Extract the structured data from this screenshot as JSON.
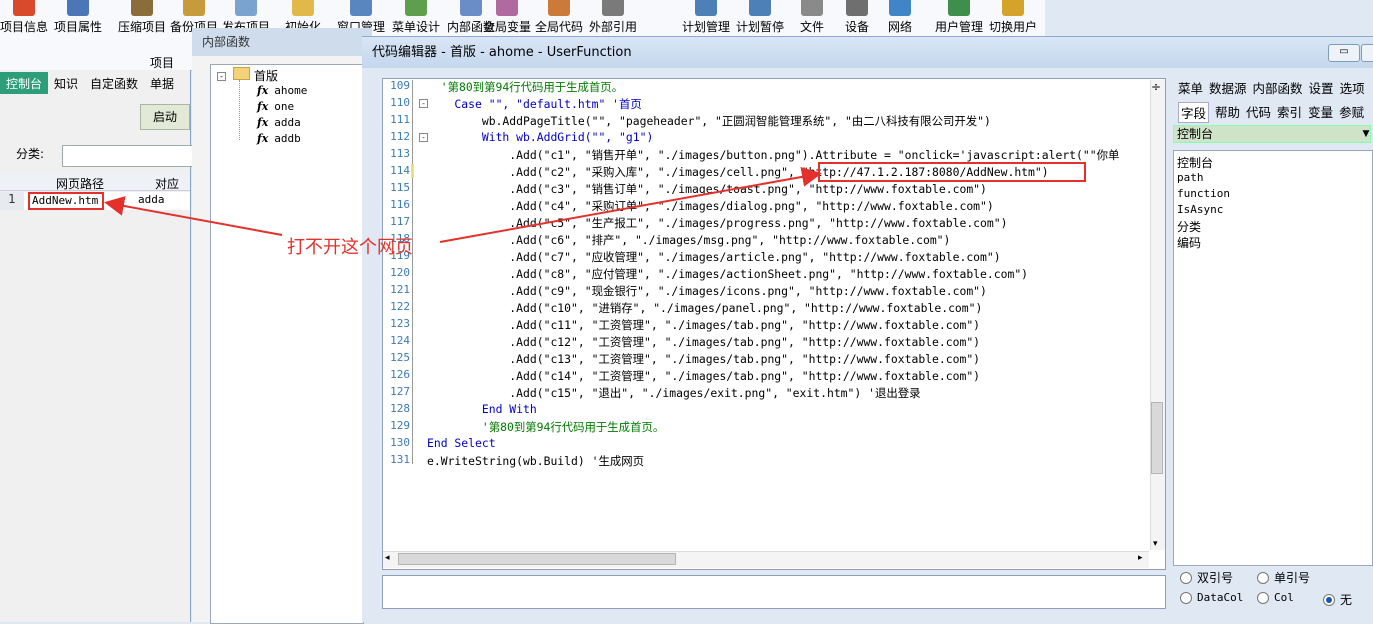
{
  "ribbon": {
    "buttons": [
      {
        "label": "项目信息",
        "color": "#d9492b"
      },
      {
        "label": "项目属性",
        "color": "#4b77b8"
      },
      {
        "label": "压缩项目",
        "color": "#8a6d3b"
      },
      {
        "label": "备份项目",
        "color": "#c79b3c"
      },
      {
        "label": "发布项目",
        "color": "#7aa3cf"
      },
      {
        "label": "初始化",
        "color": "#e0b94a"
      },
      {
        "label": "窗口管理",
        "color": "#5a86c0"
      },
      {
        "label": "菜单设计",
        "color": "#5f9e4c"
      },
      {
        "label": "内部函数",
        "color": "#6a8cc7"
      },
      {
        "label": "全局变量",
        "color": "#b06aa0"
      },
      {
        "label": "全局代码",
        "color": "#cc7a3a"
      },
      {
        "label": "外部引用",
        "color": "#7a7a7a"
      },
      {
        "label": "计划管理",
        "color": "#4e80b8"
      },
      {
        "label": "计划暂停",
        "color": "#4e80b8"
      },
      {
        "label": "文件",
        "color": "#8a8a8a"
      },
      {
        "label": "设备",
        "color": "#6f6f6f"
      },
      {
        "label": "网络",
        "color": "#3f85c7"
      },
      {
        "label": "用户管理",
        "color": "#3e8e4e"
      },
      {
        "label": "切换用户",
        "color": "#d6a32a"
      }
    ],
    "group_label": "项目"
  },
  "left": {
    "tabs": [
      "控制台",
      "知识",
      "自定函数",
      "单据"
    ],
    "start_button": "启动",
    "category_label": "分类:",
    "grid_headers": [
      "网页路径",
      "对应函"
    ],
    "row": {
      "num": "1",
      "path": "AddNew.htm",
      "func": "adda"
    }
  },
  "inner": {
    "title": "内部函数",
    "root": "首版",
    "items": [
      "ahome",
      "one",
      "adda",
      "addb"
    ]
  },
  "editor": {
    "title": "代码编辑器 - 首版 - ahome - UserFunction",
    "lines": [
      {
        "n": "109",
        "text": "  '第80到第94行代码用于生成首页。"
      },
      {
        "n": "110",
        "text": "    Case \"\", \"default.htm\" '首页"
      },
      {
        "n": "111",
        "text": "        wb.AddPageTitle(\"\", \"pageheader\", \"正圆润智能管理系统\", \"由二八科技有限公司开发\")"
      },
      {
        "n": "112",
        "text": "        With wb.AddGrid(\"\", \"g1\")"
      },
      {
        "n": "113",
        "text": "            .Add(\"c1\", \"销售开单\", \"./images/button.png\").Attribute = \"onclick='javascript:alert(\"\"你单"
      },
      {
        "n": "114",
        "text": "            .Add(\"c2\", \"采购入库\", \"./images/cell.png\", \"http://47.1.2.187:8080/AddNew.htm\")"
      },
      {
        "n": "115",
        "text": "            .Add(\"c3\", \"销售订单\", \"./images/toast.png\", \"http://www.foxtable.com\")"
      },
      {
        "n": "116",
        "text": "            .Add(\"c4\", \"采购订单\", \"./images/dialog.png\", \"http://www.foxtable.com\")"
      },
      {
        "n": "117",
        "text": "            .Add(\"c5\", \"生产报工\", \"./images/progress.png\", \"http://www.foxtable.com\")"
      },
      {
        "n": "118",
        "text": "            .Add(\"c6\", \"排产\", \"./images/msg.png\", \"http://www.foxtable.com\")"
      },
      {
        "n": "119",
        "text": "            .Add(\"c7\", \"应收管理\", \"./images/article.png\", \"http://www.foxtable.com\")"
      },
      {
        "n": "120",
        "text": "            .Add(\"c8\", \"应付管理\", \"./images/actionSheet.png\", \"http://www.foxtable.com\")"
      },
      {
        "n": "121",
        "text": "            .Add(\"c9\", \"现金银行\", \"./images/icons.png\", \"http://www.foxtable.com\")"
      },
      {
        "n": "122",
        "text": "            .Add(\"c10\", \"进销存\", \"./images/panel.png\", \"http://www.foxtable.com\")"
      },
      {
        "n": "123",
        "text": "            .Add(\"c11\", \"工资管理\", \"./images/tab.png\", \"http://www.foxtable.com\")"
      },
      {
        "n": "124",
        "text": "            .Add(\"c12\", \"工资管理\", \"./images/tab.png\", \"http://www.foxtable.com\")"
      },
      {
        "n": "125",
        "text": "            .Add(\"c13\", \"工资管理\", \"./images/tab.png\", \"http://www.foxtable.com\")"
      },
      {
        "n": "126",
        "text": "            .Add(\"c14\", \"工资管理\", \"./images/tab.png\", \"http://www.foxtable.com\")"
      },
      {
        "n": "127",
        "text": "            .Add(\"c15\", \"退出\", \"./images/exit.png\", \"exit.htm\") '退出登录"
      },
      {
        "n": "128",
        "text": "        End With"
      },
      {
        "n": "129",
        "text": "        '第80到第94行代码用于生成首页。"
      },
      {
        "n": "130",
        "text": "End Select"
      },
      {
        "n": "131",
        "text": "e.WriteString(wb.Build) '生成网页"
      }
    ]
  },
  "annotation": "打不开这个网页",
  "right": {
    "tabs1": [
      "菜单",
      "数据源",
      "内部函数",
      "设置",
      "选项"
    ],
    "tabs2": [
      "字段",
      "帮助",
      "代码",
      "索引",
      "变量",
      "参赋"
    ],
    "dropdown": "控制台",
    "list": [
      "控制台",
      "path",
      "function",
      "IsAsync",
      "分类",
      "编码"
    ],
    "radios": [
      {
        "label": "双引号",
        "on": false
      },
      {
        "label": "单引号",
        "on": false
      },
      {
        "label": "DataCol",
        "on": false
      },
      {
        "label": "Col",
        "on": false
      },
      {
        "label": "无",
        "on": true
      }
    ]
  },
  "colors": {
    "accent": "#2e9e7a",
    "annotation": "#e4312b",
    "keyword": "#0000c8",
    "comment": "#007a00"
  }
}
